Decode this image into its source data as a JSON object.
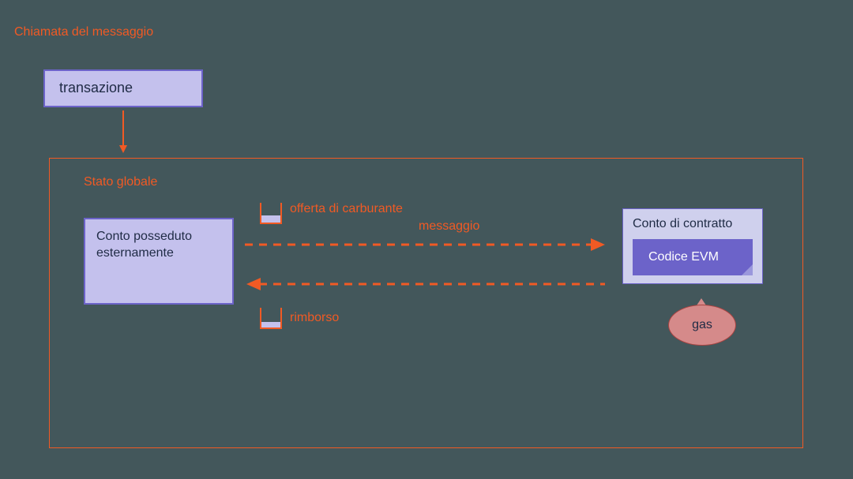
{
  "title": "Chiamata del messaggio",
  "transaction": {
    "label": "transazione"
  },
  "global_state": {
    "label": "Stato globale",
    "external_account": "Conto posseduto esternamente",
    "fuel_offer": "offerta di carburante",
    "message": "messaggio",
    "refund": "rimborso",
    "contract": {
      "title": "Conto di contratto",
      "code": "Codice EVM",
      "gas": "gas"
    }
  },
  "colors": {
    "orange": "#f15a24",
    "purple_light": "#c4c1ed",
    "purple_border": "#6c63c9",
    "purple_mid": "#6c63c9",
    "background": "#43575b",
    "red_fill": "#d58a8a",
    "red_border": "#a94442"
  }
}
